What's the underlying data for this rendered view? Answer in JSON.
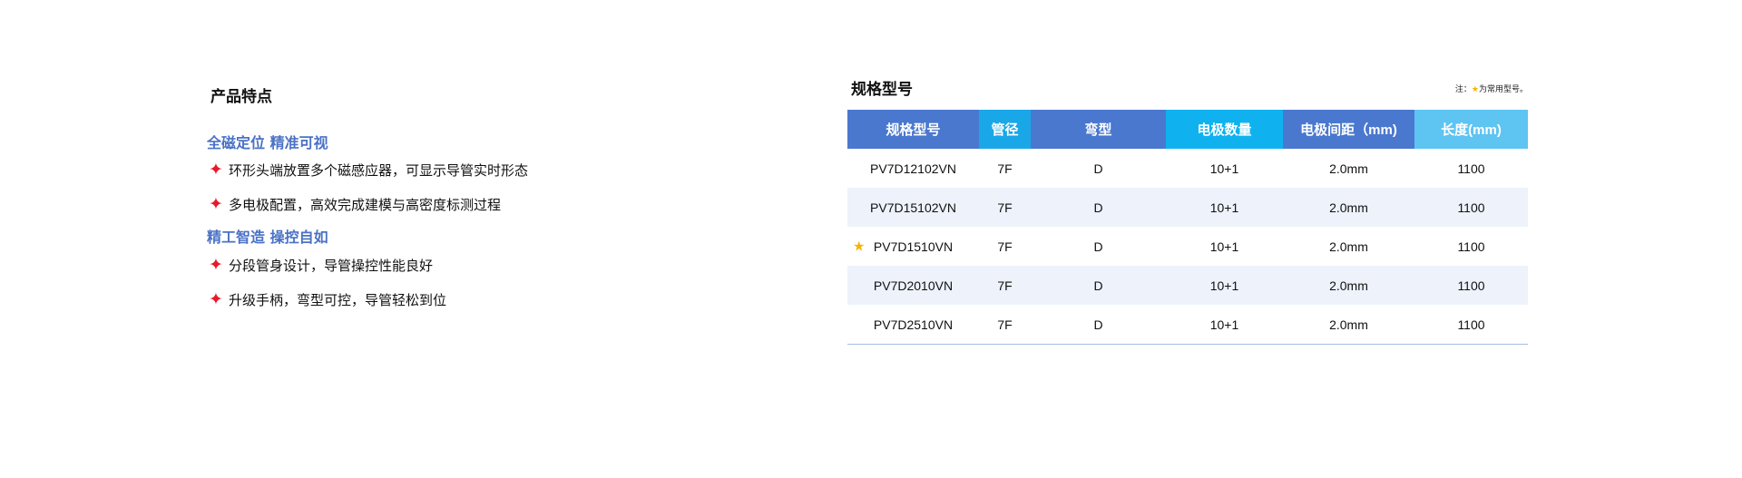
{
  "features": {
    "title": "产品特点",
    "groups": [
      {
        "title": "全磁定位 精准可视",
        "items": [
          "环形头端放置多个磁感应器，可显示导管实时形态",
          "多电极配置，高效完成建模与高密度标测过程"
        ]
      },
      {
        "title": "精工智造 操控自如",
        "items": [
          "分段管身设计，导管操控性能良好",
          "升级手柄，弯型可控，导管轻松到位"
        ]
      }
    ],
    "bullet_icon": "four-point-star-icon",
    "bullet_color": "#e8192c",
    "group_title_color": "#4a72c6"
  },
  "spec": {
    "title": "规格型号",
    "note": {
      "prefix": "注：",
      "star": "★",
      "suffix": "为常用型号。"
    },
    "columns": [
      {
        "label": "规格型号",
        "color": "#4a78cf"
      },
      {
        "label": "管径",
        "color": "#1aa7e8"
      },
      {
        "label": "弯型",
        "color": "#4a78cf"
      },
      {
        "label": "电极数量",
        "color": "#0fb2ef"
      },
      {
        "label": "电极间距（mm)",
        "color": "#4a78cf"
      },
      {
        "label": "长度(mm)",
        "color": "#5ec4f2"
      }
    ],
    "rows": [
      {
        "model": "PV7D12102VN",
        "diameter": "7F",
        "curve": "D",
        "electrodes": "10+1",
        "spacing": "2.0mm",
        "length": "1100",
        "common": false
      },
      {
        "model": "PV7D15102VN",
        "diameter": "7F",
        "curve": "D",
        "electrodes": "10+1",
        "spacing": "2.0mm",
        "length": "1100",
        "common": false
      },
      {
        "model": "PV7D1510VN",
        "diameter": "7F",
        "curve": "D",
        "electrodes": "10+1",
        "spacing": "2.0mm",
        "length": "1100",
        "common": true,
        "star": "★"
      },
      {
        "model": "PV7D2010VN",
        "diameter": "7F",
        "curve": "D",
        "electrodes": "10+1",
        "spacing": "2.0mm",
        "length": "1100",
        "common": false
      },
      {
        "model": "PV7D2510VN",
        "diameter": "7F",
        "curve": "D",
        "electrodes": "10+1",
        "spacing": "2.0mm",
        "length": "1100",
        "common": false
      }
    ],
    "common_star_color": "#f5b400"
  }
}
